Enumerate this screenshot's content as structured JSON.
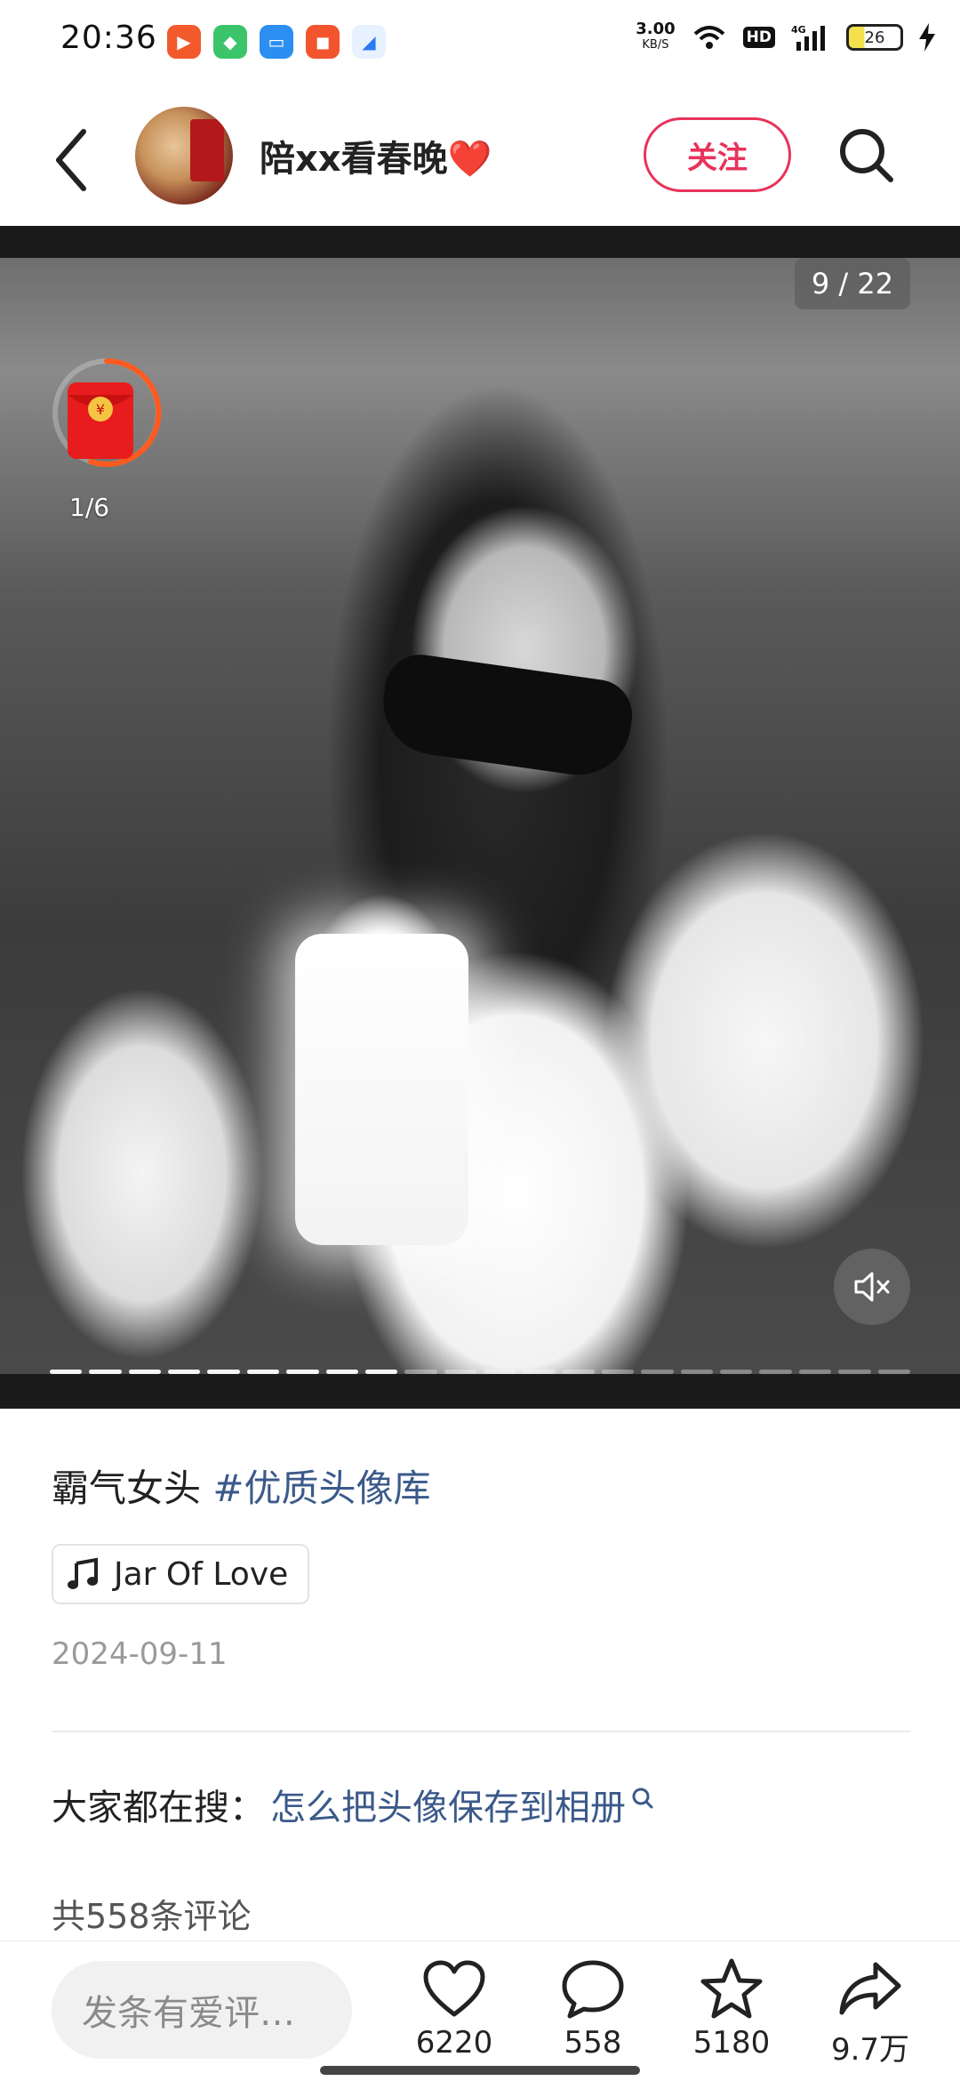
{
  "status_bar": {
    "time": "20:36",
    "net_speed_value": "3.00",
    "net_speed_unit": "KB/S",
    "hd_badge": "HD",
    "signal_label": "4G",
    "battery_level": "26"
  },
  "header": {
    "username": "陪xx看春晚❤️",
    "follow_label": "关注"
  },
  "media": {
    "page_counter": "9 / 22",
    "redpacket_progress": "1/6",
    "total_pages": 22,
    "current_page": 9
  },
  "post": {
    "caption_text": "霸气女头 ",
    "hashtag": "#优质头像库",
    "music_title": "Jar Of Love",
    "date": "2024-09-11"
  },
  "search_suggest": {
    "label": "大家都在搜：",
    "query": "怎么把头像保存到相册"
  },
  "comments": {
    "total_label": "共558条评论"
  },
  "bottom_bar": {
    "input_placeholder": "发条有爱评…",
    "likes": "6220",
    "comments": "558",
    "favorites": "5180",
    "shares": "9.7万"
  },
  "colors": {
    "accent": "#e8335a",
    "link": "#3b5a8a"
  }
}
